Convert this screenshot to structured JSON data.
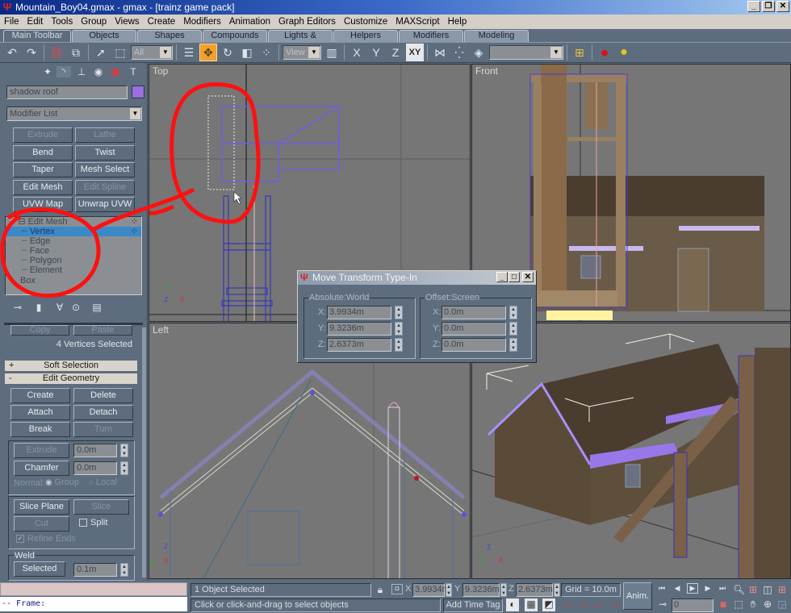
{
  "window": {
    "title": "Mountain_Boy04.gmax - gmax - [trainz game pack]",
    "controls": [
      "minimize",
      "restore",
      "close"
    ]
  },
  "menu": [
    "File",
    "Edit",
    "Tools",
    "Group",
    "Views",
    "Create",
    "Modifiers",
    "Animation",
    "Graph Editors",
    "Customize",
    "MAXScript",
    "Help"
  ],
  "tabs": [
    {
      "label": "Main Toolbar",
      "active": true
    },
    {
      "label": "Objects"
    },
    {
      "label": "Shapes"
    },
    {
      "label": "Compounds"
    },
    {
      "label": "Lights & Cameras"
    },
    {
      "label": "Helpers"
    },
    {
      "label": "Modifiers"
    },
    {
      "label": "Modeling"
    }
  ],
  "toolbar": {
    "selection_filter": "All",
    "reference_coord": "View",
    "axis_labels": [
      "X",
      "Y",
      "Z",
      "XY"
    ],
    "named_selection": "",
    "active_tool": "select-and-move"
  },
  "command_panel": {
    "object_name": "shadow roof",
    "object_color": "#9a6fe0",
    "modifier_list": "Modifier List",
    "modifier_buttons": [
      {
        "label": "Extrude",
        "enabled": false
      },
      {
        "label": "Lathe",
        "enabled": false
      },
      {
        "label": "Bend",
        "enabled": true
      },
      {
        "label": "Twist",
        "enabled": true
      },
      {
        "label": "Taper",
        "enabled": true
      },
      {
        "label": "Mesh Select",
        "enabled": true
      },
      {
        "label": "Edit Mesh",
        "enabled": true
      },
      {
        "label": "Edit Spline",
        "enabled": false
      },
      {
        "label": "UVW Map",
        "enabled": true
      },
      {
        "label": "Unwrap UVW",
        "enabled": true
      }
    ],
    "stack": [
      {
        "label": "Edit Mesh",
        "level": 0
      },
      {
        "label": "Vertex",
        "level": 1,
        "selected": true
      },
      {
        "label": "Edge",
        "level": 1
      },
      {
        "label": "Face",
        "level": 1
      },
      {
        "label": "Polygon",
        "level": 1
      },
      {
        "label": "Element",
        "level": 1
      },
      {
        "label": "Box",
        "level": 0
      }
    ],
    "copy_label": "Copy",
    "paste_label": "Paste",
    "selection_status": "4 Vertices Selected",
    "soft_selection": "Soft Selection",
    "edit_geometry": "Edit Geometry",
    "geo_buttons": [
      {
        "label": "Create",
        "enabled": true
      },
      {
        "label": "Delete",
        "enabled": true
      },
      {
        "label": "Attach",
        "enabled": true
      },
      {
        "label": "Detach",
        "enabled": true
      },
      {
        "label": "Break",
        "enabled": true
      },
      {
        "label": "Turn",
        "enabled": false
      }
    ],
    "extrude": {
      "label": "Extrude",
      "value": "0.0m"
    },
    "chamfer": {
      "label": "Chamfer",
      "value": "0.0m"
    },
    "normal_label": "Normal:",
    "normal_group": "Group",
    "normal_local": "Local",
    "slice_plane": "Slice Plane",
    "slice": "Slice",
    "cut": "Cut",
    "split": "Split",
    "refine_ends": "Refine Ends",
    "weld_label": "Weld",
    "weld_selected": "Selected",
    "weld_value": "0.1m"
  },
  "viewports": {
    "top": "Top",
    "front": "Front",
    "left": "Left",
    "perspective": ""
  },
  "dialog": {
    "title": "Move Transform Type-In",
    "absolute_label": "Absolute:World",
    "offset_label": "Offset:Screen",
    "absolute": {
      "x": "3.9934m",
      "y": "9.3236m",
      "z": "2.6373m"
    },
    "offset": {
      "x": "0.0m",
      "y": "0.0m",
      "z": "0.0m"
    }
  },
  "statusbar": {
    "maxscript_output": "",
    "maxscript_input": "-- Frame:",
    "selection": "1 Object Selected",
    "prompt": "Click or click-and-drag to select objects",
    "x": "3.9934m",
    "y": "9.3236m",
    "z": "2.6373m",
    "grid": "Grid = 10.0m",
    "anim": "Anim.",
    "add_time_tag": "Add Time Tag",
    "frame": "0"
  },
  "annotation_color": "#ff1010"
}
